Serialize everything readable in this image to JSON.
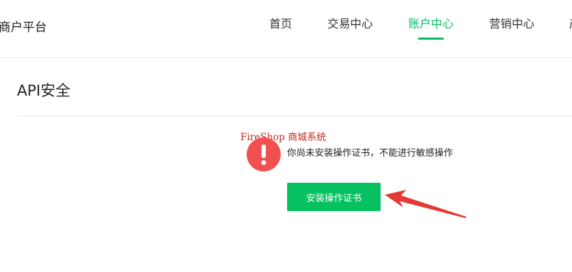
{
  "brand": "商户平台",
  "nav": {
    "items": [
      {
        "label": "首页"
      },
      {
        "label": "交易中心"
      },
      {
        "label": "账户中心",
        "active": true
      },
      {
        "label": "营销中心"
      },
      {
        "label": "产"
      }
    ]
  },
  "page": {
    "title": "API安全"
  },
  "watermark": "FireShop 商城系统",
  "notice": {
    "icon": "exclamation-circle-icon",
    "text": "你尚未安装操作证书，不能进行敏感操作"
  },
  "actions": {
    "install_label": "安装操作证书"
  },
  "annotation": {
    "icon": "pointer-arrow-icon"
  },
  "colors": {
    "accent": "#07c160",
    "warning": "#f05050",
    "watermark": "#c8281e",
    "arrow": "#e53935"
  }
}
